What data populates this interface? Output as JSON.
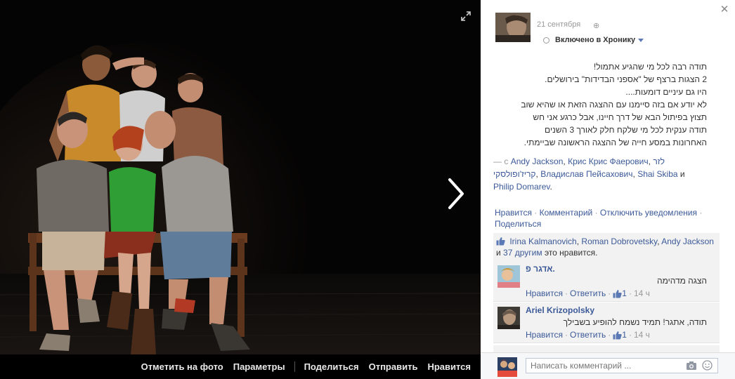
{
  "photo_actions": {
    "tag_photo": "Отметить на фото",
    "options": "Параметры",
    "share": "Поделиться",
    "send": "Отправить",
    "like": "Нравится"
  },
  "post": {
    "date": "21 сентября",
    "privacy_icon": "globe-icon",
    "timeline_label": "Включено в Хронику",
    "text_lines": [
      "תודה רבה לכל מי שהגיע אתמול!",
      "2 הצגות ברצף של \"אספני הבדידות\" בירושלים.",
      "היו גם עיניים דומעות....",
      "לא יודע אם בזה סיימנו עם ההצגה הזאת או שהיא שוב",
      "תצוץ בפיתול הבא של דרך חיינו, אבל כרגע אני חש",
      "תודה ענקית לכל מי שלקח חלק לאורך 3 השנים",
      "האחרונות במסע חייה של ההצגה הראשונה שביימתי."
    ],
    "tags": {
      "dash": "— с",
      "people": [
        "Andy Jackson",
        "Крис Крис Фаерович",
        "לזר קריז'ופולסקי",
        "Владислав Пейсахович",
        "Shai Skiba",
        "Philip Domarev"
      ],
      "and_word": "и"
    },
    "actions": [
      "Нравится",
      "Комментарий",
      "Отключить уведомления",
      "Поделиться"
    ]
  },
  "likes": {
    "names": [
      "Irina Kalmanovich",
      "Roman Dobrovetsky",
      "Andy Jackson"
    ],
    "and_word": "и",
    "others": "37 другим",
    "suffix": "это нравится."
  },
  "comments": [
    {
      "author": "אדגר פ.",
      "text": "הצגה מדהימה",
      "like": "Нравится",
      "reply": "Ответить",
      "like_count": "1",
      "time": "14 ч"
    },
    {
      "author": "Ariel Krizopolsky",
      "text": "תודה, אתגר! תמיד נשמח להופיע בשבילך",
      "like": "Нравится",
      "reply": "Ответить",
      "like_count": "1",
      "time": "14 ч"
    }
  ],
  "composer": {
    "placeholder": "Написать комментарий ..."
  },
  "colors": {
    "link": "#3b5998",
    "stage_bg": "#030303",
    "panel_bg": "#f2f2f2"
  }
}
